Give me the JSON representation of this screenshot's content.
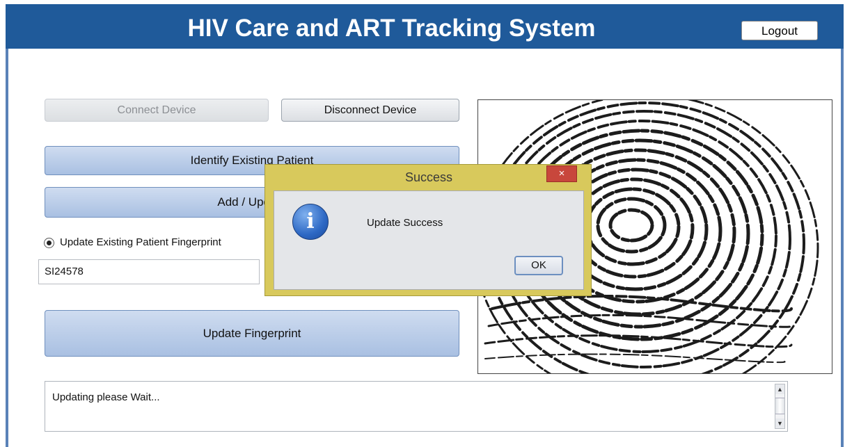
{
  "header": {
    "title": "HIV Care and ART Tracking System",
    "logout_label": "Logout"
  },
  "device": {
    "connect_label": "Connect Device",
    "disconnect_label": "Disconnect Device"
  },
  "actions": {
    "identify_label": "Identify Existing Patient",
    "add_update_label": "Add / Update",
    "update_fingerprint_label": "Update Fingerprint"
  },
  "patient": {
    "radio_label": "Update Existing Patient Fingerprint",
    "id_value": "SI24578"
  },
  "log": {
    "text": "Updating please Wait..."
  },
  "dialog": {
    "title": "Success",
    "message": "Update Success",
    "ok_label": "OK",
    "close_glyph": "×",
    "icon_glyph": "i"
  },
  "scrollbar": {
    "up_glyph": "▲",
    "down_glyph": "▼"
  },
  "colors": {
    "header_bg": "#1f5a9a",
    "accent_button": "#a9c0e2",
    "dialog_frame": "#d8c95c",
    "close_red": "#c8473c"
  },
  "icons": [
    "info-icon",
    "close-icon",
    "fingerprint-image",
    "scroll-up-icon",
    "scroll-down-icon"
  ]
}
